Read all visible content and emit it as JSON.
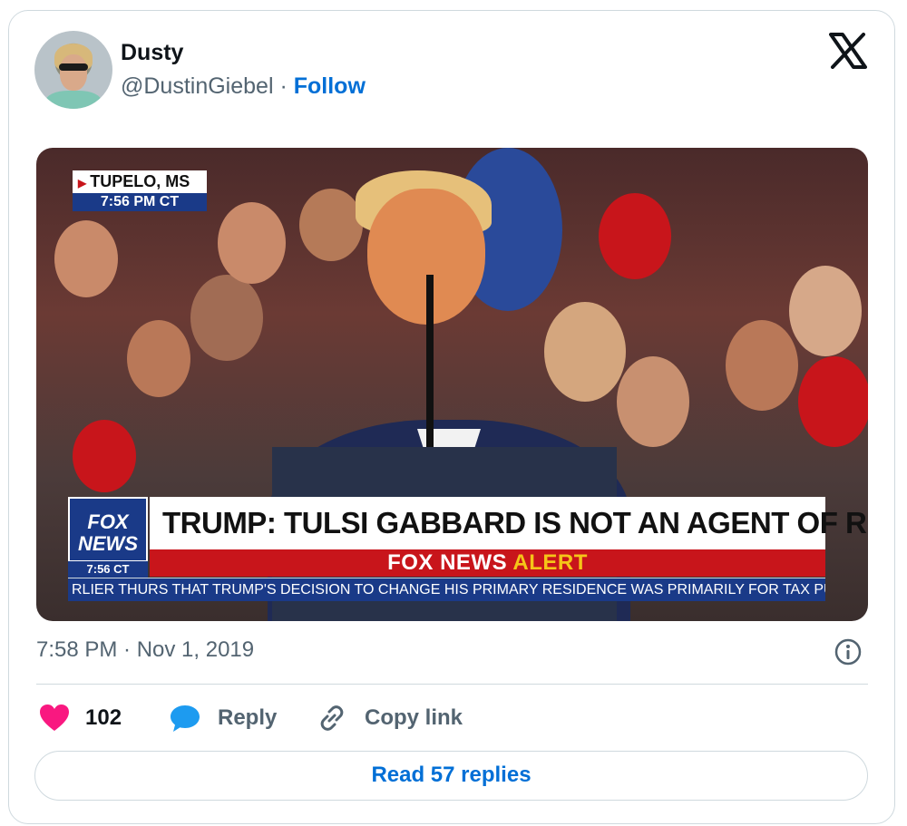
{
  "author": {
    "name": "Dusty",
    "handle": "@DustinGiebel",
    "separator": "·",
    "follow_label": "Follow"
  },
  "media": {
    "location": "TUPELO, MS",
    "local_time": "7:56 PM CT",
    "network_logo_line1": "FOX",
    "network_logo_line2": "NEWS",
    "network_time": "7:56 CT",
    "headline": "TRUMP: TULSI GABBARD IS NOT AN AGENT OF RUSSIA",
    "alert_part1": "FOX NEWS",
    "alert_part2": "ALERT",
    "ticker": "RLIER THURS THAT TRUMP'S DECISION TO CHANGE HIS PRIMARY RESIDENCE WAS PRIMARILY FOR TAX PURP"
  },
  "timestamp": "7:58 PM · Nov 1, 2019",
  "actions": {
    "likes": "102",
    "reply_label": "Reply",
    "copy_link_label": "Copy link"
  },
  "read_replies_label": "Read 57 replies",
  "colors": {
    "brand_blue": "#006fd6",
    "like_pink": "#f91880",
    "reply_blue": "#1d9bf0",
    "muted": "#536471",
    "fox_blue": "#1a3a88",
    "fox_red": "#c8151b"
  }
}
